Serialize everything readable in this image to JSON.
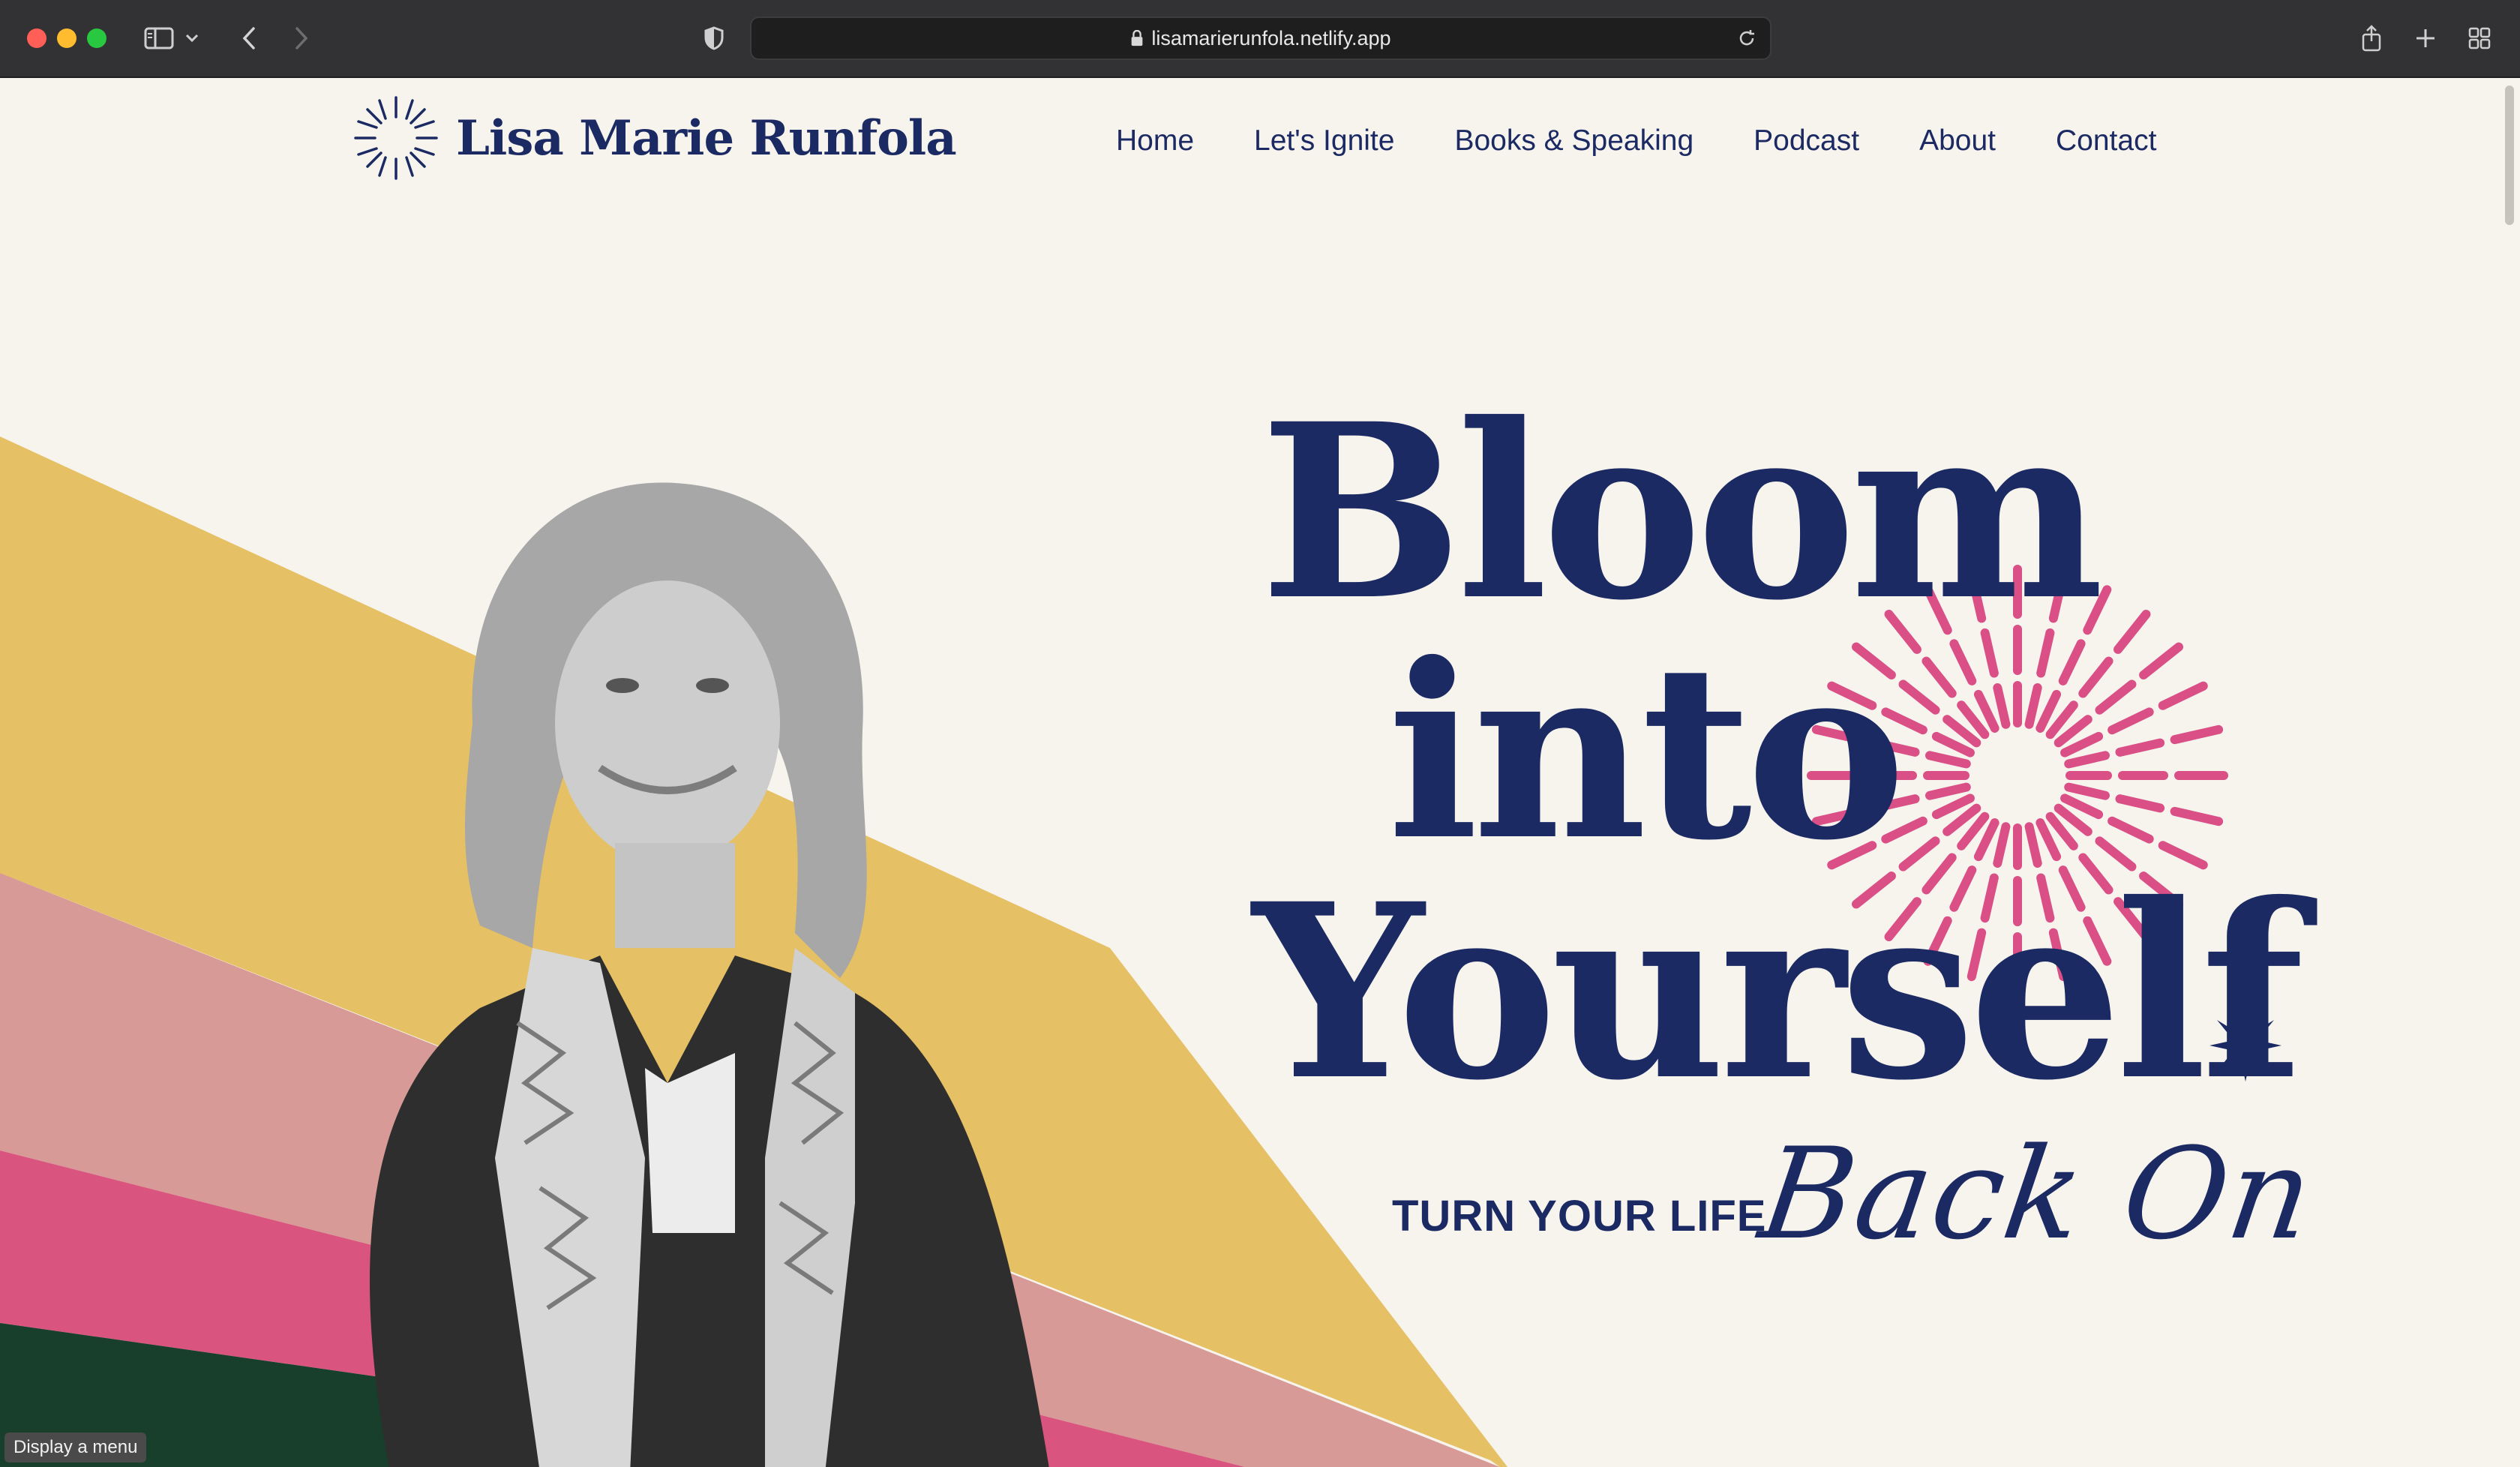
{
  "browser": {
    "url": "lisamarierunfola.netlify.app"
  },
  "site": {
    "brand_name": "Lisa Marie Runfola",
    "nav": [
      "Home",
      "Let's Ignite",
      "Books & Speaking",
      "Podcast",
      "About",
      "Contact"
    ]
  },
  "hero": {
    "headline": [
      "Bloom",
      "into",
      "Yourself"
    ],
    "tagline": "TURN YOUR LIFE",
    "script": "Back On"
  },
  "tooltip": "Display a menu",
  "colors": {
    "navy": "#1b2a63",
    "cream": "#f7f4ee",
    "mustard": "#e5c064",
    "dusty_pink": "#d89a96",
    "magenta": "#d9557f",
    "forest": "#173f2c",
    "burst_pink": "#d94f86"
  }
}
